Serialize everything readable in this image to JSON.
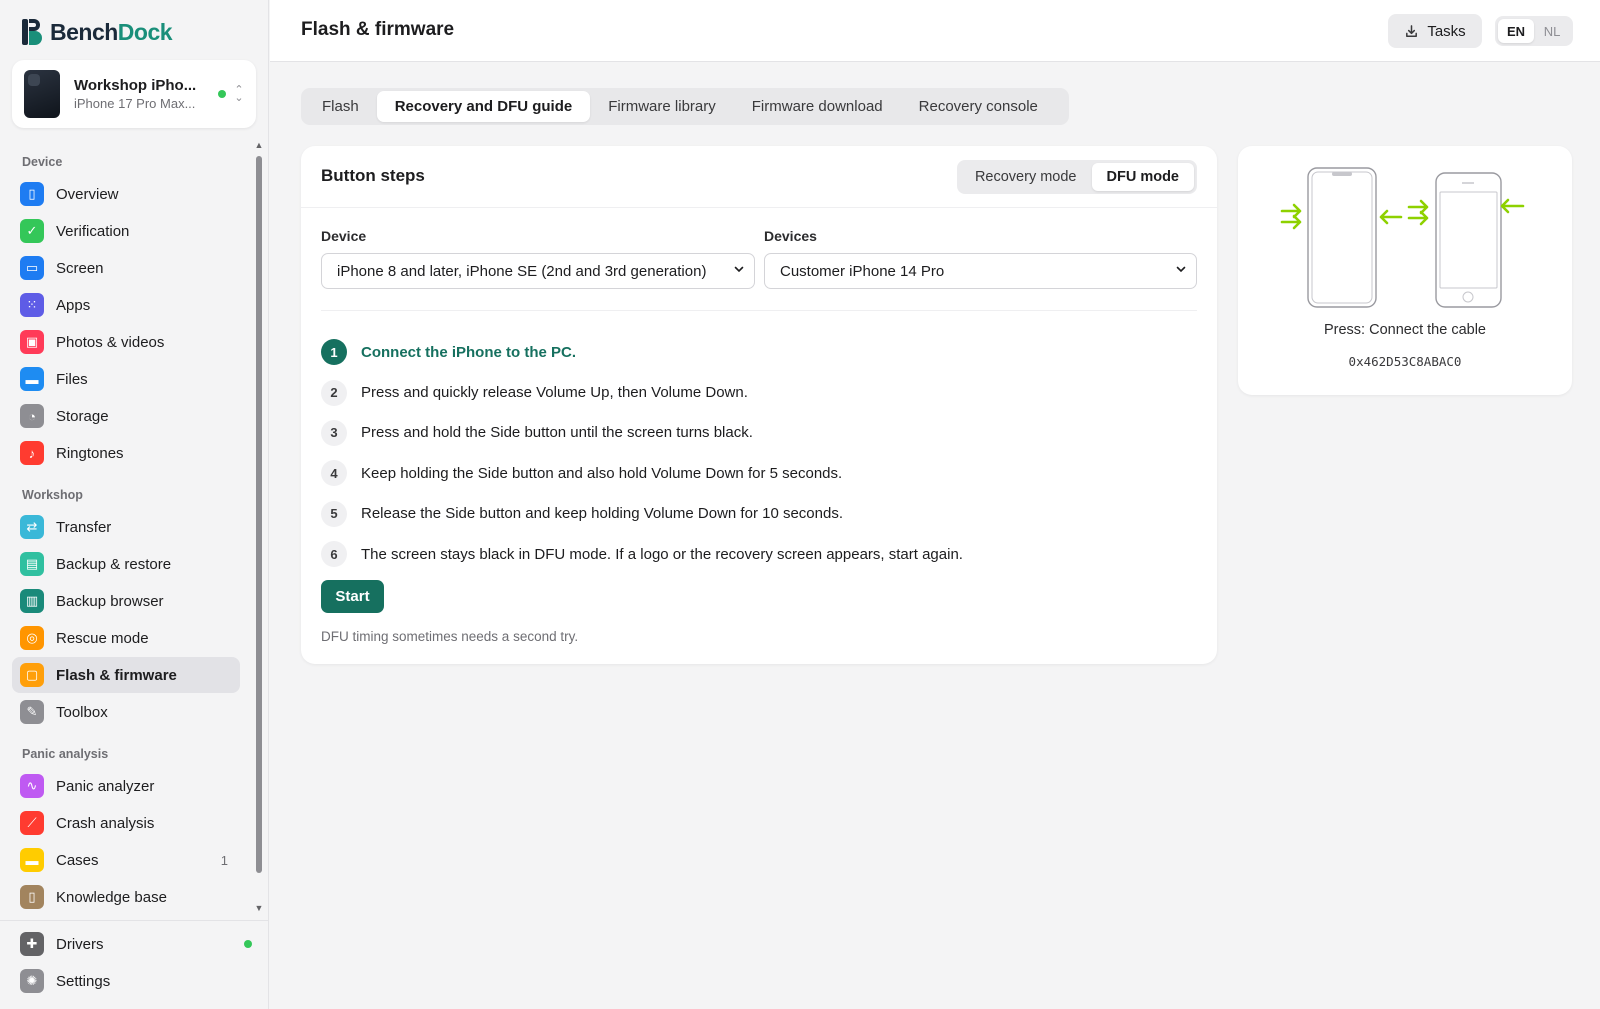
{
  "app": {
    "name_part1": "Bench",
    "name_part2": "Dock"
  },
  "device_card": {
    "name": "Workshop iPho...",
    "model": "iPhone 17 Pro Max..."
  },
  "sidebar": {
    "sections": [
      {
        "title": "Device",
        "items": [
          {
            "label": "Overview",
            "icon": "phone-icon",
            "color": "#1e7cf2"
          },
          {
            "label": "Verification",
            "icon": "shield-check-icon",
            "color": "#34c759"
          },
          {
            "label": "Screen",
            "icon": "screen-icon",
            "color": "#1e7cf2"
          },
          {
            "label": "Apps",
            "icon": "grid-icon",
            "color": "#5e5ce6"
          },
          {
            "label": "Photos & videos",
            "icon": "photo-icon",
            "color": "#ff3b58"
          },
          {
            "label": "Files",
            "icon": "folder-icon",
            "color": "#1e8cf2"
          },
          {
            "label": "Storage",
            "icon": "pie-icon",
            "color": "#8e8e93"
          },
          {
            "label": "Ringtones",
            "icon": "music-icon",
            "color": "#ff3b30"
          }
        ]
      },
      {
        "title": "Workshop",
        "items": [
          {
            "label": "Transfer",
            "icon": "transfer-icon",
            "color": "#3ab8d8"
          },
          {
            "label": "Backup & restore",
            "icon": "archive-icon",
            "color": "#30c0a0"
          },
          {
            "label": "Backup browser",
            "icon": "tray-icon",
            "color": "#1a8a7a"
          },
          {
            "label": "Rescue mode",
            "icon": "lifebuoy-icon",
            "color": "#ff9500"
          },
          {
            "label": "Flash & firmware",
            "icon": "chip-icon",
            "color": "#ff9f0a",
            "active": true
          },
          {
            "label": "Toolbox",
            "icon": "wrench-icon",
            "color": "#8e8e93"
          }
        ]
      },
      {
        "title": "Panic analysis",
        "items": [
          {
            "label": "Panic analyzer",
            "icon": "waveform-icon",
            "color": "#bf5af2"
          },
          {
            "label": "Crash analysis",
            "icon": "chart-line-icon",
            "color": "#ff3b30"
          },
          {
            "label": "Cases",
            "icon": "folder-icon",
            "color": "#ffcc00",
            "count": "1"
          },
          {
            "label": "Knowledge base",
            "icon": "book-icon",
            "color": "#a2845e"
          }
        ]
      }
    ],
    "bottom": [
      {
        "label": "Drivers",
        "icon": "puzzle-icon",
        "color": "#636366",
        "status": true
      },
      {
        "label": "Settings",
        "icon": "gear-icon",
        "color": "#8e8e93"
      }
    ]
  },
  "header": {
    "title": "Flash & firmware",
    "tasks_label": "Tasks",
    "lang": [
      "EN",
      "NL"
    ]
  },
  "tabs": [
    "Flash",
    "Recovery and DFU guide",
    "Firmware library",
    "Firmware download",
    "Recovery console"
  ],
  "card": {
    "title": "Button steps",
    "modes": [
      "Recovery mode",
      "DFU mode"
    ],
    "device_label": "Device",
    "device_value": "iPhone 8 and later, iPhone SE (2nd and 3rd generation)",
    "devices_label": "Devices",
    "devices_value": "Customer iPhone 14 Pro",
    "steps": [
      "Connect the iPhone to the PC.",
      "Press and quickly release Volume Up, then Volume Down.",
      "Press and hold the Side button until the screen turns black.",
      "Keep holding the Side button and also hold Volume Down for 5 seconds.",
      "Release the Side button and keep holding Volume Down for 10 seconds.",
      "The screen stays black in DFU mode. If a logo or the recovery screen appears, start again."
    ],
    "step_numbers": [
      "1",
      "2",
      "3",
      "4",
      "5",
      "6"
    ],
    "start_label": "Start",
    "note": "DFU timing sometimes needs a second try."
  },
  "illustration": {
    "caption": "Press: Connect the cable",
    "code": "0x462D53C8ABAC0",
    "accent": "#8ed100"
  }
}
